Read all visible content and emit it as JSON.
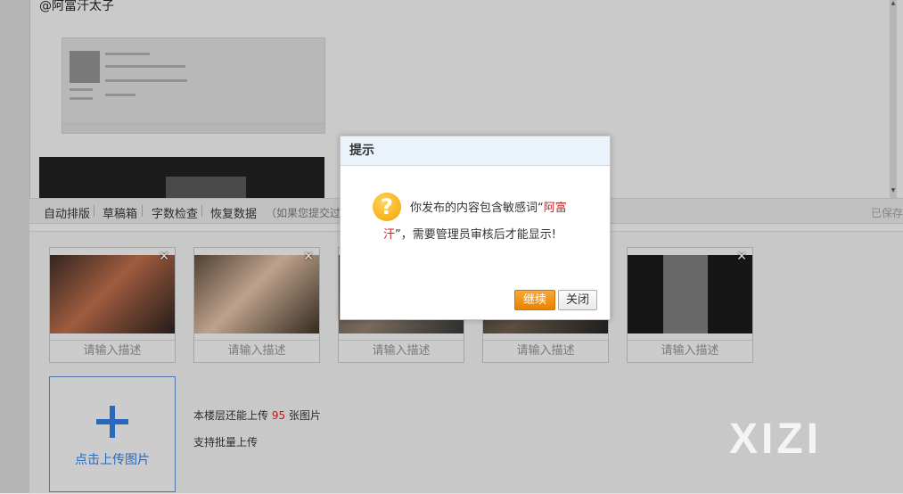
{
  "editor": {
    "mention_text": "@阿富汗太子"
  },
  "toolbar": {
    "auto_layout": "自动排版",
    "drafts": "草稿箱",
    "word_count": "字数检查",
    "restore": "恢复数据",
    "hint": "（如果您提交过一",
    "saved": "已保存"
  },
  "thumbnails": {
    "desc_placeholder": "请输入描述",
    "close_glyph": "✕"
  },
  "upload": {
    "button_label": "点击上传图片",
    "remaining_prefix": "本楼层还能上传",
    "remaining_count": "95",
    "remaining_suffix": "张图片",
    "batch_support": "支持批量上传"
  },
  "watermark": "XIZI",
  "dialog": {
    "title": "提示",
    "icon": "question-icon",
    "message_before": "你发布的内容包含敏感词“",
    "sensitive_word": "阿富汗",
    "message_after": "”，需要管理员审核后才能显示!",
    "continue_label": "继续",
    "close_label": "关闭"
  },
  "colors": {
    "highlight_red": "#d02222",
    "continue_orange": "#e78400",
    "upload_blue": "#2f78d8"
  }
}
